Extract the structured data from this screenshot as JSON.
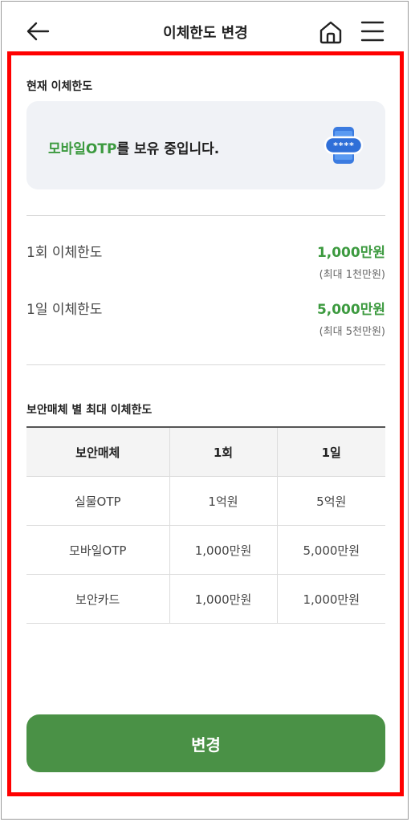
{
  "header": {
    "title": "이체한도 변경",
    "back_icon": "arrow-left-icon",
    "home_icon": "home-icon",
    "menu_icon": "hamburger-menu-icon"
  },
  "current": {
    "section_title": "현재 이체한도",
    "otp_accent": "모바일OTP",
    "otp_rest": "를 보유 중입니다.",
    "otp_icon": "mobile-otp-icon",
    "otp_icon_text": "****"
  },
  "limits": [
    {
      "label": "1회 이체한도",
      "value": "1,000만원",
      "max": "(최대 1천만원)"
    },
    {
      "label": "1일 이체한도",
      "value": "5,000만원",
      "max": "(최대 5천만원)"
    }
  ],
  "security_table": {
    "title": "보안매체 별 최대 이체한도",
    "headers": [
      "보안매체",
      "1회",
      "1일"
    ],
    "rows": [
      [
        "실물OTP",
        "1억원",
        "5억원"
      ],
      [
        "모바일OTP",
        "1,000만원",
        "5,000만원"
      ],
      [
        "보안카드",
        "1,000만원",
        "1,000만원"
      ]
    ]
  },
  "footer": {
    "change_label": "변경"
  },
  "colors": {
    "accent": "#3c9a3f",
    "button": "#4a9146",
    "highlight": "#ff0000"
  }
}
